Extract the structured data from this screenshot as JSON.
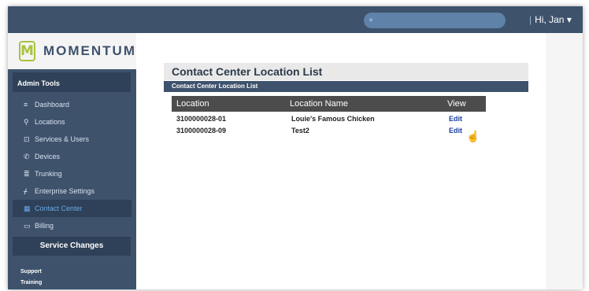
{
  "header": {
    "greeting": "Hi, Jan",
    "search_placeholder": ""
  },
  "sidebar": {
    "logo_mark": "M",
    "logo_text": "MOMENTUM",
    "section_title": "Admin Tools",
    "items": [
      {
        "icon": "≡",
        "label": "Dashboard"
      },
      {
        "icon": "⚲",
        "label": "Locations"
      },
      {
        "icon": "⊡",
        "label": "Services & Users"
      },
      {
        "icon": "✆",
        "label": "Devices"
      },
      {
        "icon": "≣",
        "label": "Trunking"
      },
      {
        "icon": "ᚋ",
        "label": "Enterprise Settings"
      },
      {
        "icon": "▦",
        "label": "Contact Center"
      },
      {
        "icon": "▭",
        "label": "Billing"
      }
    ],
    "service_changes": "Service Changes",
    "support": "Support",
    "training": "Training"
  },
  "main": {
    "title": "Contact Center Location List",
    "subtitle": "Contact Center Location List",
    "columns": [
      "Location",
      "Location Name",
      "View"
    ],
    "rows": [
      {
        "location": "3100000028-01",
        "name": "Louie's Famous Chicken",
        "view": "Edit"
      },
      {
        "location": "3100000028-09",
        "name": "Test2",
        "view": "Edit"
      }
    ]
  },
  "colors": {
    "nav_bg": "#3e526c",
    "accent_logo": "#a9c23f",
    "active_item": "#6aa9e8",
    "link": "#1a3fa0"
  }
}
